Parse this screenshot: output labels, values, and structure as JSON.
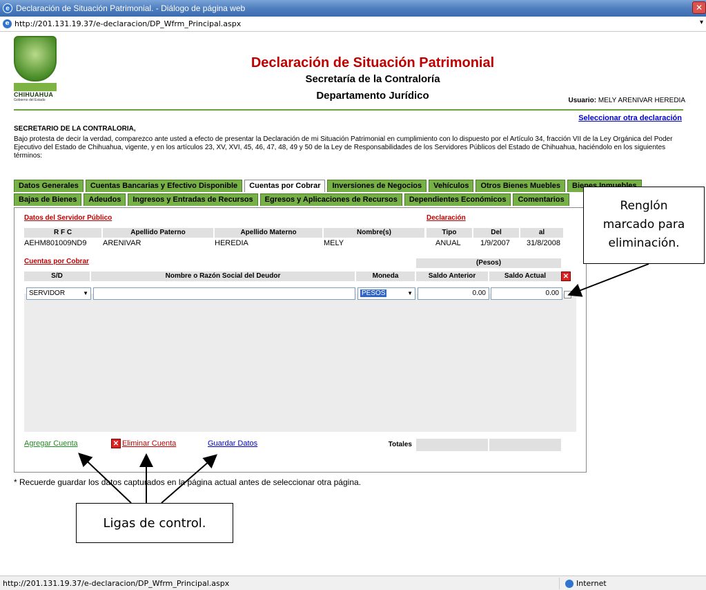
{
  "window": {
    "title": "Declaración de Situación Patrimonial. - Diálogo de página web",
    "url": "http://201.131.19.37/e-declaracion/DP_Wfrm_Principal.aspx"
  },
  "logo": {
    "state": "CHIHUAHUA",
    "sub": "Gobierno del Estado"
  },
  "header": {
    "title": "Declaración de Situación Patrimonial",
    "subtitle1": "Secretaría de la Contraloría",
    "subtitle2": "Departamento Jurídico",
    "usuario_label": "Usuario:",
    "usuario_name": "MELY ARENIVAR HEREDIA",
    "select_other": "Seleccionar otra declaración"
  },
  "intro": {
    "addressee": "SECRETARIO DE LA CONTRALORIA,",
    "text": "Bajo protesta de decir la verdad, comparezco ante usted a efecto de presentar la Declaración de mi Situación Patrimonial en cumplimiento con lo dispuesto por el Artículo 34, fracción VII de la Ley Orgánica del Poder Ejecutivo del Estado de Chihuahua, vigente, y en los artículos 23, XV, XVI, 45, 46, 47, 48, 49 y 50 de la Ley de Responsabilidades de los Servidores Públicos del Estado de Chihuahua, haciéndolo en los siguientes términos:"
  },
  "tabs_row1": [
    "Datos Generales",
    "Cuentas Bancarias y Efectivo Disponible",
    "Cuentas por Cobrar",
    "Inversiones de Negocios",
    "Vehículos",
    "Otros Bienes Muebles",
    "Bienes Inmuebles"
  ],
  "tabs_row2": [
    "Bajas de Bienes",
    "Adeudos",
    "Ingresos y Entradas de Recursos",
    "Egresos y Aplicaciones de Recursos",
    "Dependientes Económicos",
    "Comentarios"
  ],
  "servidor": {
    "section_label": "Datos del Servidor Público",
    "headers": [
      "R F C",
      "Apellido Paterno",
      "Apellido Materno",
      "Nombre(s)"
    ],
    "values": [
      "AEHM801009ND9",
      "ARENIVAR",
      "HEREDIA",
      "MELY"
    ]
  },
  "declaracion": {
    "section_label": "Declaración",
    "headers": [
      "Tipo",
      "Del",
      "al"
    ],
    "values": [
      "ANUAL",
      "1/9/2007",
      "31/8/2008"
    ]
  },
  "cuentas": {
    "section_label": "Cuentas por Cobrar",
    "pesos_label": "(Pesos)",
    "headers": [
      "S/D",
      "Nombre o Razón Social del Deudor",
      "Moneda",
      "Saldo Anterior",
      "Saldo Actual"
    ],
    "row": {
      "sd": "SERVIDOR",
      "nombre": "",
      "moneda": "PESOS",
      "saldo_anterior": "0.00",
      "saldo_actual": "0.00"
    }
  },
  "controls": {
    "agregar": "Agregar Cuenta",
    "eliminar": "Eliminar Cuenta",
    "guardar": "Guardar Datos",
    "totales": "Totales"
  },
  "note": "* Recuerde guardar los datos capturados en la página actual antes de seleccionar otra página.",
  "callouts": {
    "renglon_line1": "Renglón",
    "renglon_line2": "marcado para",
    "renglon_line3": "eliminación.",
    "ligas": "Ligas de control."
  },
  "status": {
    "url": "http://201.131.19.37/e-declaracion/DP_Wfrm_Principal.aspx",
    "zone": "Internet"
  },
  "colors": {
    "accent_red": "#c00000",
    "tab_green": "#76b046",
    "link_blue": "#0000cc"
  }
}
